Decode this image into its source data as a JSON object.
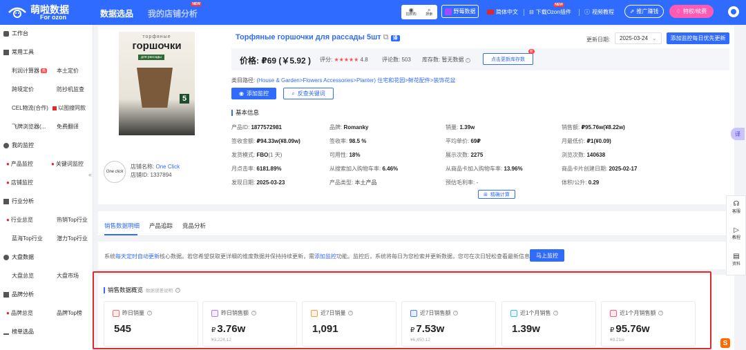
{
  "topbar": {
    "logo_text": "萌啦数据",
    "logo_sub": "For ozon",
    "tabs": [
      {
        "label": "数据选品"
      },
      {
        "label": "我的店铺分析",
        "badge": "NEW"
      }
    ],
    "small_tools": [
      "拍照购",
      "搜索"
    ],
    "wild_data": "野莓数据",
    "lang": "简体中文",
    "download": "下载Ozon插件",
    "download_badge": "NEW",
    "video": "视频教程",
    "promo": "推广赚钱",
    "vip": "特权/续费"
  },
  "sidebar": {
    "sections": [
      {
        "label": "工作台"
      },
      {
        "label": "常用工具"
      },
      {
        "label": "我的监控"
      },
      {
        "label": "行业分析"
      },
      {
        "label": "大盘数据"
      },
      {
        "label": "品牌分析"
      },
      {
        "label": "榜单选品"
      }
    ],
    "items": [
      "利润计算器",
      "本土定价",
      "跨境定价",
      "防抄机监查",
      "CEL物流(合作)",
      "以图搜同款",
      "飞牌浏览器(...",
      "免费翻译",
      "产品监控",
      "关键词监控",
      "店铺监控",
      "行业总览",
      "热销Top行业",
      "蓝海Top行业",
      "潜力Top行业",
      "大盘总览",
      "大盘市场",
      "品牌总览",
      "品牌Top榜"
    ],
    "hot_badge": "热"
  },
  "product": {
    "image_text_top": "торфяные",
    "image_text_main": "горшочки",
    "image_text_sub": "для рассады",
    "image_number": "5",
    "title": "Торфяные горшочки для рассады 5шт",
    "translate_label": "译",
    "price_label": "价格:",
    "price": "₽69 (￥5.92 )",
    "rating_label": "评分:",
    "stars": "★★★★★",
    "rating": "4.8",
    "reviews": "评论数: 503",
    "stock": "库存数: 暂无数据",
    "update_stock_btn": "点击更新库存数",
    "new_badge": "新",
    "update_date_label": "更新日期:",
    "update_date": "2025-03-24",
    "add_monitor_top": "添加监控每日优先更新",
    "category_label": "类目路径:",
    "category": "(House & Garden>Flowers Accessories>Planter) 住宅和花园>鲜花配件>装饰花盆",
    "add_monitor": "添加监控",
    "reverse_kw": "反查关键词",
    "basic_info": "基本信息",
    "shop_name_label": "店铺名称:",
    "shop_name": "One Click",
    "shop_id": "店铺ID: 1337894",
    "shop_logo": "One click",
    "precise_calc": "精确计算"
  },
  "info_grid": [
    [
      {
        "k": "产品ID:",
        "v": "1877572981"
      },
      {
        "k": "品牌:",
        "v": "Romanky"
      },
      {
        "k": "销量:",
        "v": "1.39w"
      },
      {
        "k": "销售额:",
        "v": "₽95.76w(¥8.22w)"
      }
    ],
    [
      {
        "k": "签收金额:",
        "v": "₽94.33w(¥8.09w)"
      },
      {
        "k": "签收率:",
        "v": "98.5 %"
      },
      {
        "k": "平均单价:",
        "v": "69₽"
      },
      {
        "k": "月最低价:",
        "v": "₽1(¥0.09)"
      }
    ],
    [
      {
        "k": "发货模式:",
        "v": "FBO",
        "extra": "(1 天)"
      },
      {
        "k": "可用性:",
        "v": "18%"
      },
      {
        "k": "展示次数:",
        "v": "2275"
      },
      {
        "k": "浏览次数:",
        "v": "140638"
      }
    ],
    [
      {
        "k": "月点击率:",
        "v": "6181.89%"
      },
      {
        "k": "从搜索加入购物车率:",
        "v": "6.46%"
      },
      {
        "k": "从商品卡加入购物车率:",
        "v": "13.96%"
      },
      {
        "k": "商品卡片创建日期:",
        "v": "2025-02-17"
      }
    ],
    [
      {
        "k": "发现日期:",
        "v": "2025-03-23"
      },
      {
        "k": "产品类型:",
        "v": "本土产品",
        "plain": true
      },
      {
        "k": "预估毛利率:",
        "v": "-",
        "plain": true
      },
      {
        "k": "体积/公升:",
        "v": "0.29"
      }
    ]
  ],
  "tabs": [
    {
      "label": "销售数据明细"
    },
    {
      "label": "产品追踪"
    },
    {
      "label": "竞品分析"
    }
  ],
  "notice": {
    "prefix": "系统",
    "link1": "每天定时自动更新",
    "mid": "核心数据。若您希望获取更详细的维度数据并保持持续更新，需",
    "link2": "添加监控",
    "suffix": "功能。监控后，系统将每日为您检索并更新数据，您可在次日轻松查看最新信息。",
    "button": "马上监控"
  },
  "overview": {
    "title": "销售数据概览",
    "note": "数据误差说明"
  },
  "stats": [
    {
      "label": "昨日销量",
      "value": "545",
      "currency": "",
      "sub": "",
      "color": "#ff6b6b"
    },
    {
      "label": "昨日销售额",
      "value": "3.76w",
      "currency": "₽",
      "sub": "¥3,224.12",
      "color": "#b07cff"
    },
    {
      "label": "近7日销量",
      "value": "1,091",
      "currency": "",
      "sub": "",
      "color": "#ff9a4d"
    },
    {
      "label": "近7日销售额",
      "value": "7.53w",
      "currency": "₽",
      "sub": "¥6,450.12",
      "color": "#4d7cff"
    },
    {
      "label": "近1个月销售",
      "value": "1.39w",
      "currency": "",
      "sub": "",
      "color": "#39b8ff"
    },
    {
      "label": "近1个月销售额",
      "value": "95.76w",
      "currency": "₽",
      "sub": "¥8.21w",
      "color": "#ff5a7a"
    }
  ],
  "right_side": [
    "客服",
    "教程",
    "资料"
  ],
  "translate_float": "译"
}
